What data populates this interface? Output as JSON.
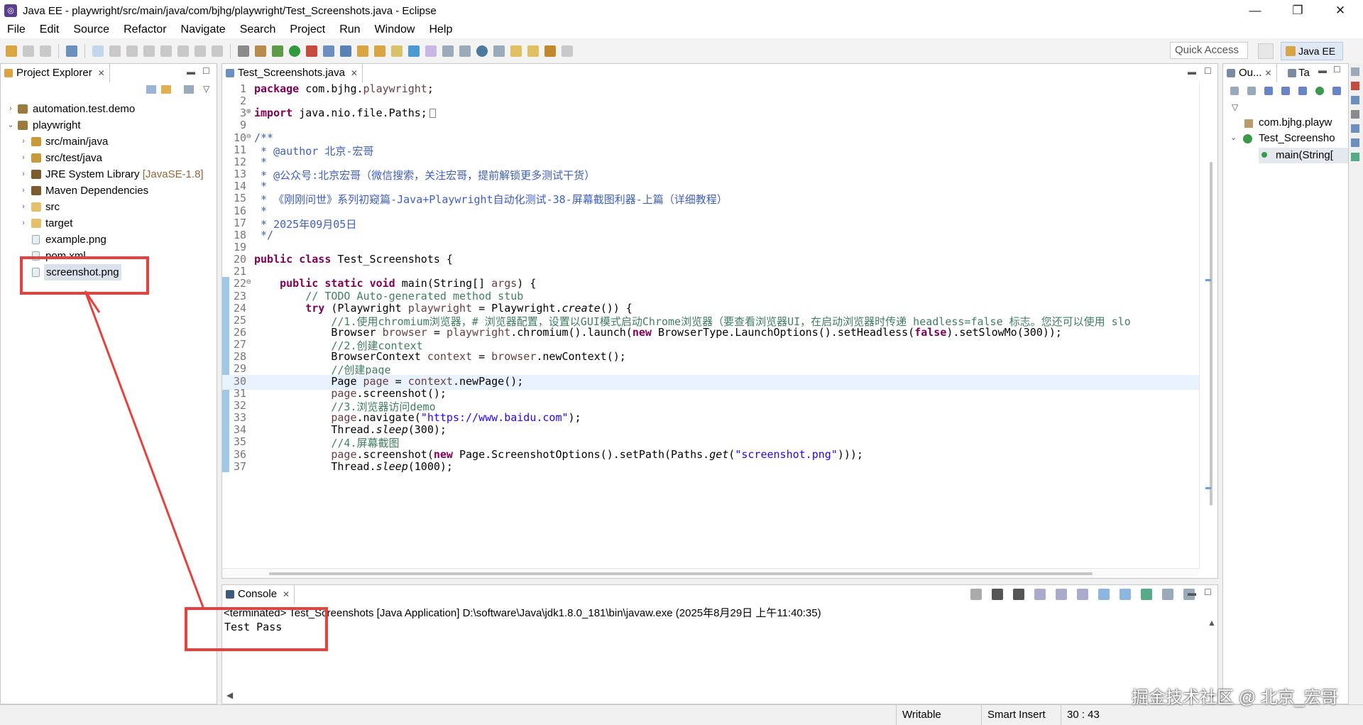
{
  "window": {
    "title": "Java EE - playwright/src/main/java/com/bjhg/playwright/Test_Screenshots.java - Eclipse"
  },
  "menu": [
    "File",
    "Edit",
    "Source",
    "Refactor",
    "Navigate",
    "Search",
    "Project",
    "Run",
    "Window",
    "Help"
  ],
  "toolbar": {
    "quick_access_placeholder": "Quick Access",
    "perspective": "Java EE"
  },
  "project_explorer": {
    "title": "Project Explorer",
    "items": [
      {
        "label": "automation.test.demo",
        "decoration": ""
      },
      {
        "label": "playwright",
        "decoration": ""
      },
      {
        "label": "src/main/java",
        "decoration": ""
      },
      {
        "label": "src/test/java",
        "decoration": ""
      },
      {
        "label": "JRE System Library",
        "decoration": "[JavaSE-1.8]"
      },
      {
        "label": "Maven Dependencies",
        "decoration": ""
      },
      {
        "label": "src",
        "decoration": ""
      },
      {
        "label": "target",
        "decoration": ""
      },
      {
        "label": "example.png",
        "decoration": ""
      },
      {
        "label": "pom.xml",
        "decoration": ""
      },
      {
        "label": "screenshot.png",
        "decoration": ""
      }
    ]
  },
  "editor": {
    "tab": "Test_Screenshots.java",
    "lines": [
      {
        "n": "1",
        "t": "package com.bjhg.playwright;"
      },
      {
        "n": "2",
        "t": ""
      },
      {
        "n": "3",
        "t": "import java.nio.file.Paths;"
      },
      {
        "n": "9",
        "t": ""
      },
      {
        "n": "10",
        "t": "/**"
      },
      {
        "n": "11",
        "t": " * @author 北京-宏哥"
      },
      {
        "n": "12",
        "t": " *"
      },
      {
        "n": "13",
        "t": " * @公众号:北京宏哥（微信搜索，关注宏哥，提前解锁更多测试干货）"
      },
      {
        "n": "14",
        "t": " *"
      },
      {
        "n": "15",
        "t": " * 《刚刚问世》系列初窥篇-Java+Playwright自动化测试-38-屏幕截图利器-上篇（详细教程）"
      },
      {
        "n": "16",
        "t": " *"
      },
      {
        "n": "17",
        "t": " * 2025年09月05日"
      },
      {
        "n": "18",
        "t": " */"
      },
      {
        "n": "19",
        "t": ""
      },
      {
        "n": "20",
        "t": "public class Test_Screenshots {"
      },
      {
        "n": "21",
        "t": ""
      },
      {
        "n": "22",
        "t": "    public static void main(String[] args) {"
      },
      {
        "n": "23",
        "t": "        // TODO Auto-generated method stub"
      },
      {
        "n": "24",
        "t": "        try (Playwright playwright = Playwright.create()) {"
      },
      {
        "n": "25",
        "t": "            //1.使用chromium浏览器，# 浏览器配置，设置以GUI模式启动Chrome浏览器（要查看浏览器UI，在启动浏览器时传递 headless=false 标志。您还可以使用 slo"
      },
      {
        "n": "26",
        "t": "            Browser browser = playwright.chromium().launch(new BrowserType.LaunchOptions().setHeadless(false).setSlowMo(300));"
      },
      {
        "n": "27",
        "t": "            //2.创建context"
      },
      {
        "n": "28",
        "t": "            BrowserContext context = browser.newContext();"
      },
      {
        "n": "29",
        "t": "            //创建page"
      },
      {
        "n": "30",
        "t": "            Page page = context.newPage();"
      },
      {
        "n": "31",
        "t": "            page.screenshot();"
      },
      {
        "n": "32",
        "t": "            //3.浏览器访问demo"
      },
      {
        "n": "33",
        "t": "            page.navigate(\"https://www.baidu.com\");"
      },
      {
        "n": "34",
        "t": "            Thread.sleep(300);"
      },
      {
        "n": "35",
        "t": "            //4.屏幕截图"
      },
      {
        "n": "36",
        "t": "            page.screenshot(new Page.ScreenshotOptions().setPath(Paths.get(\"screenshot.png\")));"
      },
      {
        "n": "37",
        "t": "            Thread.sleep(1000);"
      }
    ]
  },
  "console": {
    "tab": "Console",
    "header": "<terminated> Test_Screenshots [Java Application] D:\\software\\Java\\jdk1.8.0_181\\bin\\javaw.exe (2025年8月29日 上午11:40:35)",
    "output": "Test Pass"
  },
  "outline": {
    "tab1": "Ou...",
    "tab2": "Ta",
    "items": [
      "com.bjhg.playw",
      "Test_Screensho",
      "main(String["
    ]
  },
  "status": {
    "writable": "Writable",
    "insert": "Smart Insert",
    "position": "30 : 43"
  },
  "watermark": "掘金技术社区 @ 北京_宏哥",
  "colors": {
    "annotation_red": "#e8403f",
    "keyword": "#7f0055",
    "comment": "#3f7f5f",
    "string": "#2a00ff"
  }
}
